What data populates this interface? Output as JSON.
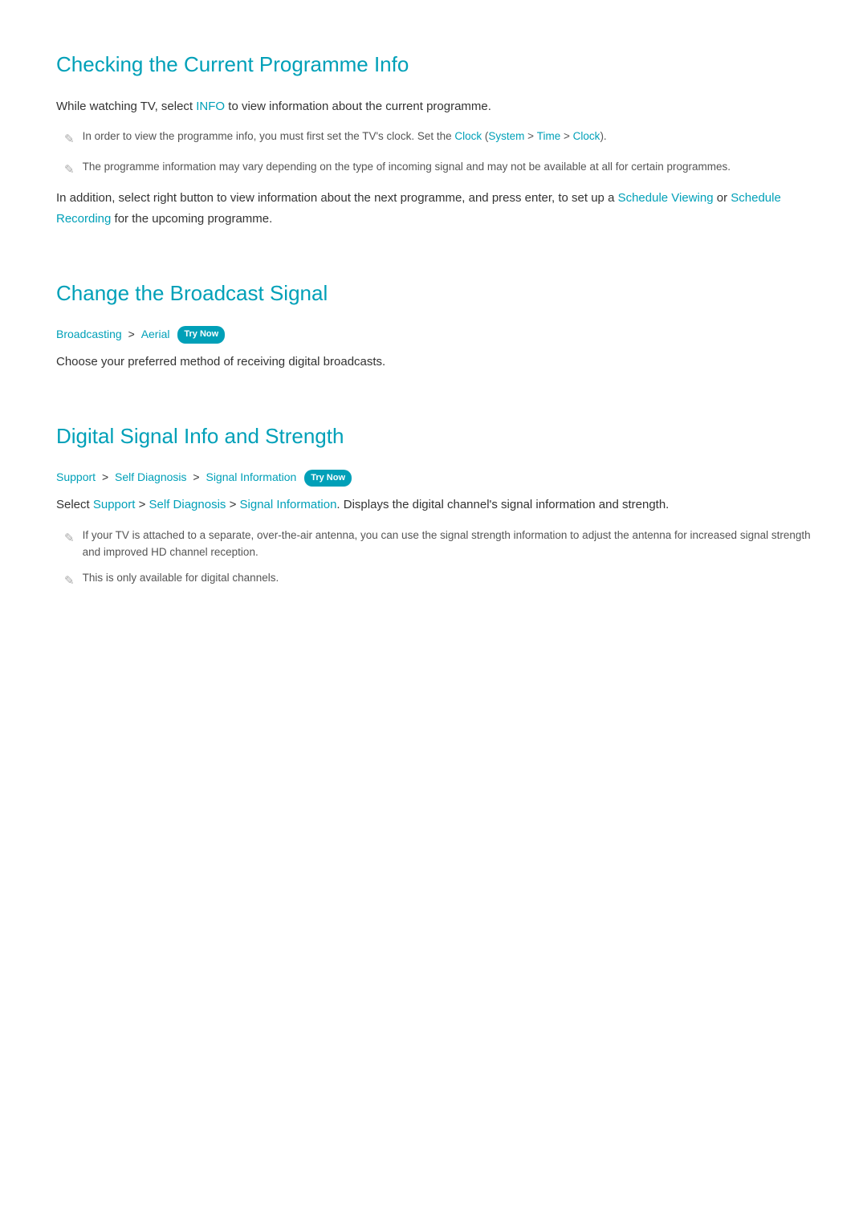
{
  "sections": {
    "section1": {
      "title": "Checking the Current Programme Info",
      "intro": "While watching TV, select INFO to view information about the current programme.",
      "intro_link": "INFO",
      "note1": "In order to view the programme info, you must first set the TV's clock. Set the Clock (System > Time > Clock).",
      "note1_links": [
        "Clock",
        "System",
        "Time",
        "Clock"
      ],
      "note2": "The programme information may vary depending on the type of incoming signal and may not be available at all for certain programmes.",
      "body2": "In addition, select right button to view information about the next programme, and press enter, to set up a Schedule Viewing or Schedule Recording for the upcoming programme.",
      "body2_links": [
        "Schedule Viewing",
        "Schedule Recording"
      ]
    },
    "section2": {
      "title": "Change the Broadcast Signal",
      "breadcrumb": [
        {
          "text": "Broadcasting",
          "type": "link"
        },
        {
          "text": ">",
          "type": "separator"
        },
        {
          "text": "Aerial",
          "type": "link"
        }
      ],
      "try_now_label": "Try Now",
      "body": "Choose your preferred method of receiving digital broadcasts."
    },
    "section3": {
      "title": "Digital Signal Info and Strength",
      "breadcrumb": [
        {
          "text": "Support",
          "type": "link"
        },
        {
          "text": ">",
          "type": "separator"
        },
        {
          "text": "Self Diagnosis",
          "type": "link"
        },
        {
          "text": ">",
          "type": "separator"
        },
        {
          "text": "Signal Information",
          "type": "link"
        }
      ],
      "try_now_label": "Try Now",
      "body_prefix": "Select ",
      "body_links": [
        "Support",
        "Self Diagnosis",
        "Signal Information"
      ],
      "body_suffix": ". Displays the digital channel's signal information and strength.",
      "note1": "If your TV is attached to a separate, over-the-air antenna, you can use the signal strength information to adjust the antenna for increased signal strength and improved HD channel reception.",
      "note2": "This is only available for digital channels."
    }
  }
}
